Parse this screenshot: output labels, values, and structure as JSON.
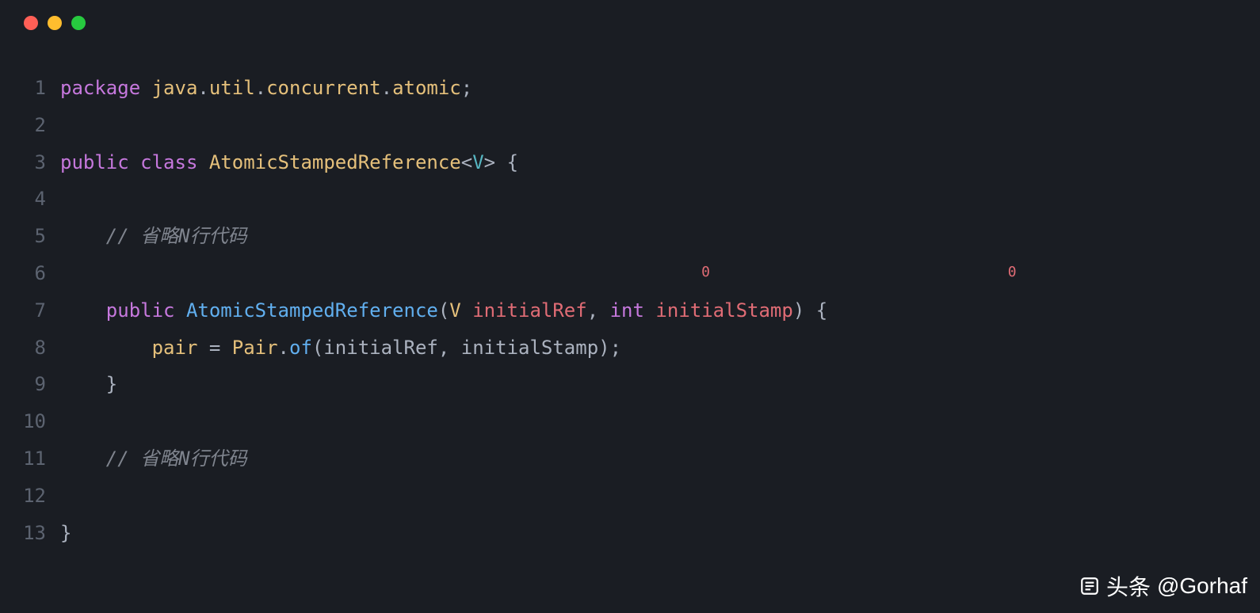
{
  "window": {
    "dots": [
      "red",
      "yellow",
      "green"
    ]
  },
  "code": {
    "lines": [
      {
        "num": "1",
        "tokens": [
          {
            "cls": "tok-keyword",
            "t": "package"
          },
          {
            "cls": "tok-plain",
            "t": " "
          },
          {
            "cls": "tok-namespace",
            "t": "java"
          },
          {
            "cls": "tok-dot",
            "t": "."
          },
          {
            "cls": "tok-namespace",
            "t": "util"
          },
          {
            "cls": "tok-dot",
            "t": "."
          },
          {
            "cls": "tok-namespace",
            "t": "concurrent"
          },
          {
            "cls": "tok-dot",
            "t": "."
          },
          {
            "cls": "tok-namespace",
            "t": "atomic"
          },
          {
            "cls": "tok-punct",
            "t": ";"
          }
        ]
      },
      {
        "num": "2",
        "tokens": []
      },
      {
        "num": "3",
        "tokens": [
          {
            "cls": "tok-keyword",
            "t": "public"
          },
          {
            "cls": "tok-plain",
            "t": " "
          },
          {
            "cls": "tok-keyword",
            "t": "class"
          },
          {
            "cls": "tok-plain",
            "t": " "
          },
          {
            "cls": "tok-class",
            "t": "AtomicStampedReference"
          },
          {
            "cls": "tok-punct",
            "t": "<"
          },
          {
            "cls": "tok-generic",
            "t": "V"
          },
          {
            "cls": "tok-punct",
            "t": ">"
          },
          {
            "cls": "tok-plain",
            "t": " "
          },
          {
            "cls": "tok-punct",
            "t": "{"
          }
        ]
      },
      {
        "num": "4",
        "tokens": []
      },
      {
        "num": "5",
        "tokens": [
          {
            "cls": "tok-plain",
            "t": "    "
          },
          {
            "cls": "tok-comment",
            "t": "// 省略N行代码"
          }
        ]
      },
      {
        "num": "6",
        "tokens": [
          {
            "cls": "tok-plain",
            "t": "                                                        "
          },
          {
            "cls": "tok-annotation",
            "t": "0"
          },
          {
            "cls": "tok-plain",
            "t": "                          "
          },
          {
            "cls": "tok-annotation",
            "t": "0"
          }
        ]
      },
      {
        "num": "7",
        "tokens": [
          {
            "cls": "tok-plain",
            "t": "    "
          },
          {
            "cls": "tok-keyword",
            "t": "public"
          },
          {
            "cls": "tok-plain",
            "t": " "
          },
          {
            "cls": "tok-method",
            "t": "AtomicStampedReference"
          },
          {
            "cls": "tok-punct",
            "t": "("
          },
          {
            "cls": "tok-type",
            "t": "V"
          },
          {
            "cls": "tok-plain",
            "t": " "
          },
          {
            "cls": "tok-param",
            "t": "initialRef"
          },
          {
            "cls": "tok-punct",
            "t": ","
          },
          {
            "cls": "tok-plain",
            "t": " "
          },
          {
            "cls": "tok-keyword",
            "t": "int"
          },
          {
            "cls": "tok-plain",
            "t": " "
          },
          {
            "cls": "tok-param",
            "t": "initialStamp"
          },
          {
            "cls": "tok-punct",
            "t": ")"
          },
          {
            "cls": "tok-plain",
            "t": " "
          },
          {
            "cls": "tok-punct",
            "t": "{"
          }
        ]
      },
      {
        "num": "8",
        "tokens": [
          {
            "cls": "tok-plain",
            "t": "        "
          },
          {
            "cls": "tok-var",
            "t": "pair"
          },
          {
            "cls": "tok-plain",
            "t": " "
          },
          {
            "cls": "tok-punct",
            "t": "="
          },
          {
            "cls": "tok-plain",
            "t": " "
          },
          {
            "cls": "tok-class",
            "t": "Pair"
          },
          {
            "cls": "tok-dot",
            "t": "."
          },
          {
            "cls": "tok-method",
            "t": "of"
          },
          {
            "cls": "tok-punct",
            "t": "("
          },
          {
            "cls": "tok-plain",
            "t": "initialRef"
          },
          {
            "cls": "tok-punct",
            "t": ","
          },
          {
            "cls": "tok-plain",
            "t": " "
          },
          {
            "cls": "tok-plain",
            "t": "initialStamp"
          },
          {
            "cls": "tok-punct",
            "t": ")"
          },
          {
            "cls": "tok-punct",
            "t": ";"
          }
        ]
      },
      {
        "num": "9",
        "tokens": [
          {
            "cls": "tok-plain",
            "t": "    "
          },
          {
            "cls": "tok-punct",
            "t": "}"
          }
        ]
      },
      {
        "num": "10",
        "tokens": []
      },
      {
        "num": "11",
        "tokens": [
          {
            "cls": "tok-plain",
            "t": "    "
          },
          {
            "cls": "tok-comment",
            "t": "// 省略N行代码"
          }
        ]
      },
      {
        "num": "12",
        "tokens": []
      },
      {
        "num": "13",
        "tokens": [
          {
            "cls": "tok-punct",
            "t": "}"
          }
        ]
      }
    ]
  },
  "watermark": {
    "brand": "头条",
    "handle": "@Gorhaf"
  }
}
